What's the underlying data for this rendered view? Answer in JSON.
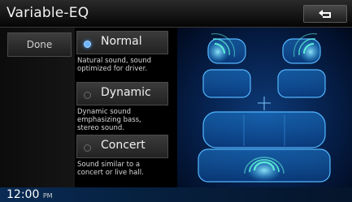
{
  "header": {
    "title": "Variable-EQ",
    "back_icon": "back-arrow-icon"
  },
  "sidebar": {
    "done_label": "Done"
  },
  "options": [
    {
      "label": "Normal",
      "selected": true,
      "description_lines": [
        "Natural sound, sound",
        "optimized for driver."
      ]
    },
    {
      "label": "Dynamic",
      "selected": false,
      "description_lines": [
        "Dynamic sound",
        "emphasizing bass,",
        "stereo sound."
      ]
    },
    {
      "label": "Concert",
      "selected": false,
      "description_lines": [
        "Sound similar to a",
        "concert or live hall."
      ]
    }
  ],
  "status": {
    "time": "12:00",
    "ampm": "PM"
  },
  "colors": {
    "accent": "#6db6ff",
    "diagram_bg": "#072452",
    "seat_glow": "#3fb8ff",
    "wave": "#5ff0d8"
  }
}
